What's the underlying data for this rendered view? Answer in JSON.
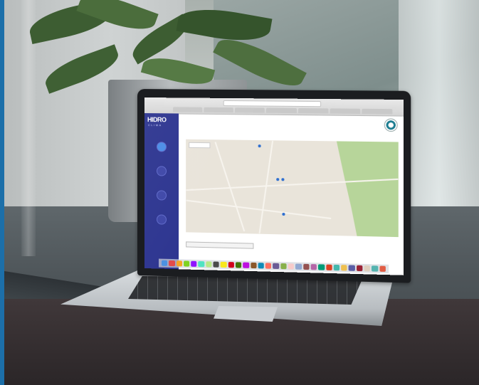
{
  "scene": {
    "description_type": "photo",
    "colors": {
      "sidebar": "#2d3590",
      "map_green": "#b7d59a",
      "accent_blue": "#1c6fa9"
    }
  },
  "browser": {
    "url": "",
    "tabs": [
      "",
      "",
      "",
      "",
      "",
      "",
      ""
    ]
  },
  "app": {
    "logo": "HIDRO",
    "logo_sub": "CLIMA",
    "nav_items": [
      {
        "label": "",
        "icon": "map-icon",
        "active": true
      },
      {
        "label": "",
        "icon": "chart-icon",
        "active": false
      },
      {
        "label": "",
        "icon": "data-icon",
        "active": false
      },
      {
        "label": "",
        "icon": "station-icon",
        "active": false
      }
    ],
    "map_toggle": "",
    "select_label": "",
    "select_value": ""
  },
  "map_pins": 4,
  "dock_icon_colors": [
    "#4a90e2",
    "#e24a4a",
    "#f5a623",
    "#7ed321",
    "#9013fe",
    "#50e3c2",
    "#b8e986",
    "#4a4a4a",
    "#f8e71c",
    "#d0021b",
    "#417505",
    "#bd10e0",
    "#8b572a",
    "#0f8ab8",
    "#ff6f61",
    "#6b5b95",
    "#88b04b",
    "#f7cac9",
    "#92a8d1",
    "#955251",
    "#b565a7",
    "#009b77",
    "#dd4124",
    "#45b8ac",
    "#efc050",
    "#5b5ea6",
    "#9b2335",
    "#dfcfbe",
    "#55b4b0",
    "#e15d44"
  ]
}
